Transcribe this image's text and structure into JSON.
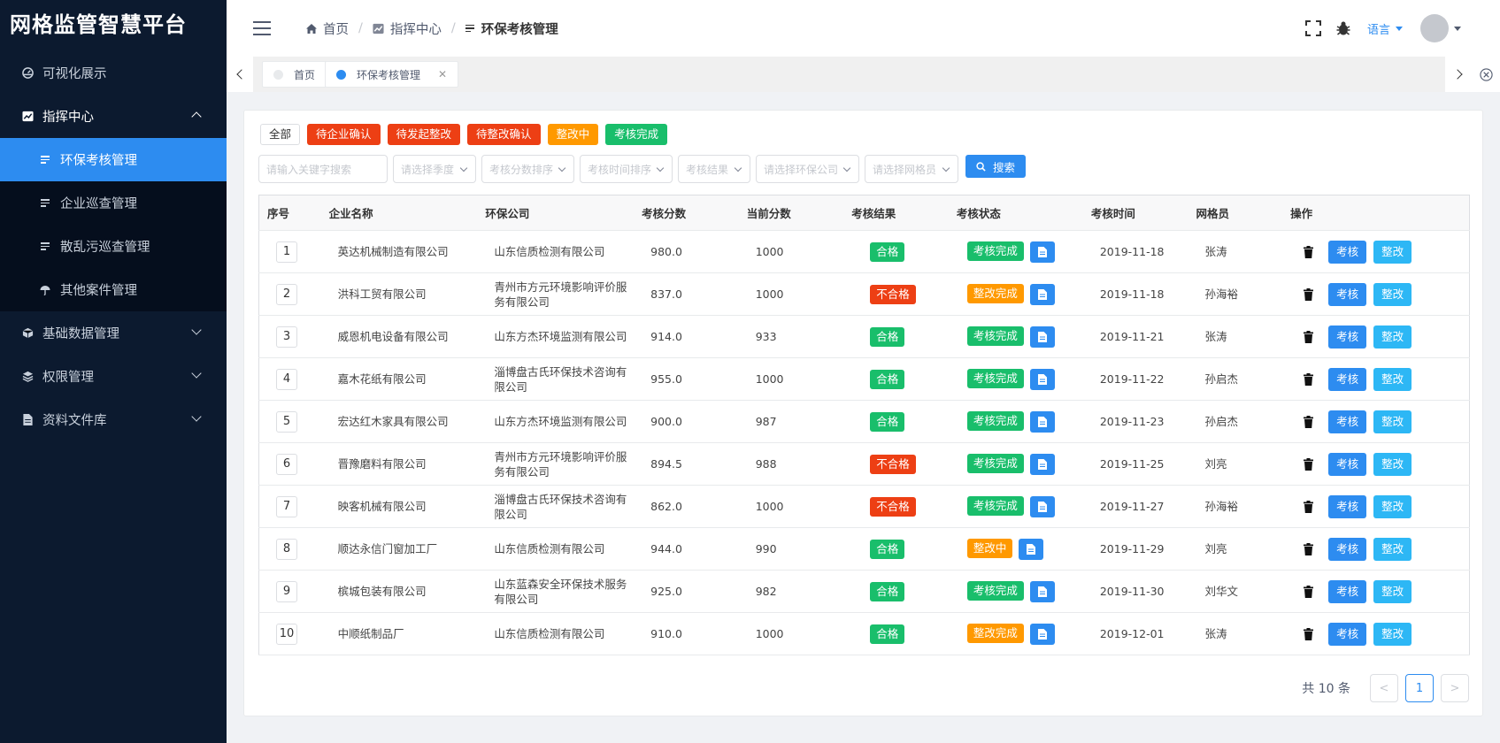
{
  "app": {
    "title": "网格监管智慧平台"
  },
  "sidebar": {
    "items": [
      {
        "label": "可视化展示",
        "icon": "dashboard-icon"
      },
      {
        "label": "指挥中心",
        "icon": "chart-icon",
        "open": true,
        "children": [
          {
            "label": "环保考核管理",
            "active": true
          },
          {
            "label": "企业巡查管理"
          },
          {
            "label": "散乱污巡查管理"
          },
          {
            "label": "其他案件管理"
          }
        ]
      },
      {
        "label": "基础数据管理",
        "icon": "cube-icon"
      },
      {
        "label": "权限管理",
        "icon": "layers-icon"
      },
      {
        "label": "资料文件库",
        "icon": "document-icon"
      }
    ]
  },
  "header": {
    "breadcrumb": [
      "首页",
      "指挥中心",
      "环保考核管理"
    ],
    "language_label": "语言"
  },
  "tabs": [
    {
      "label": "首页"
    },
    {
      "label": "环保考核管理",
      "active": true
    }
  ],
  "filters": {
    "tags": [
      {
        "label": "全部",
        "style": "plain"
      },
      {
        "label": "待企业确认",
        "style": "red"
      },
      {
        "label": "待发起整改",
        "style": "red"
      },
      {
        "label": "待整改确认",
        "style": "red"
      },
      {
        "label": "整改中",
        "style": "orange"
      },
      {
        "label": "考核完成",
        "style": "green"
      }
    ],
    "keyword_placeholder": "请输入关键字搜索",
    "selects": [
      "请选择季度",
      "考核分数排序",
      "考核时间排序",
      "考核结果",
      "请选择环保公司",
      "请选择网格员"
    ],
    "search_label": "搜索"
  },
  "table": {
    "columns": [
      "序号",
      "企业名称",
      "环保公司",
      "考核分数",
      "当前分数",
      "考核结果",
      "考核状态",
      "考核时间",
      "网格员",
      "操作"
    ],
    "op_labels": {
      "review": "考核",
      "rectify": "整改"
    },
    "rows": [
      {
        "idx": "1",
        "company": "英达机械制造有限公司",
        "eco": "山东信质检测有限公司",
        "score": "980.0",
        "current": "1000",
        "result": "合格",
        "result_color": "green",
        "status": "考核完成",
        "status_color": "green",
        "date": "2019-11-18",
        "grid": "张涛"
      },
      {
        "idx": "2",
        "company": "洪科工贸有限公司",
        "eco": "青州市方元环境影响评价服务有限公司",
        "score": "837.0",
        "current": "1000",
        "result": "不合格",
        "result_color": "red",
        "status": "整改完成",
        "status_color": "orange",
        "date": "2019-11-18",
        "grid": "孙海裕"
      },
      {
        "idx": "3",
        "company": "威恩机电设备有限公司",
        "eco": "山东方杰环境监测有限公司",
        "score": "914.0",
        "current": "933",
        "result": "合格",
        "result_color": "green",
        "status": "考核完成",
        "status_color": "green",
        "date": "2019-11-21",
        "grid": "张涛"
      },
      {
        "idx": "4",
        "company": "嘉木花纸有限公司",
        "eco": "淄博盘古氏环保技术咨询有限公司",
        "score": "955.0",
        "current": "1000",
        "result": "合格",
        "result_color": "green",
        "status": "考核完成",
        "status_color": "green",
        "date": "2019-11-22",
        "grid": "孙启杰"
      },
      {
        "idx": "5",
        "company": "宏达红木家具有限公司",
        "eco": "山东方杰环境监测有限公司",
        "score": "900.0",
        "current": "987",
        "result": "合格",
        "result_color": "green",
        "status": "考核完成",
        "status_color": "green",
        "date": "2019-11-23",
        "grid": "孙启杰"
      },
      {
        "idx": "6",
        "company": "晋豫磨料有限公司",
        "eco": "青州市方元环境影响评价服务有限公司",
        "score": "894.5",
        "current": "988",
        "result": "不合格",
        "result_color": "red",
        "status": "考核完成",
        "status_color": "green",
        "date": "2019-11-25",
        "grid": "刘亮"
      },
      {
        "idx": "7",
        "company": "映客机械有限公司",
        "eco": "淄博盘古氏环保技术咨询有限公司",
        "score": "862.0",
        "current": "1000",
        "result": "不合格",
        "result_color": "red",
        "status": "考核完成",
        "status_color": "green",
        "date": "2019-11-27",
        "grid": "孙海裕"
      },
      {
        "idx": "8",
        "company": "顺达永信门窗加工厂",
        "eco": "山东信质检测有限公司",
        "score": "944.0",
        "current": "990",
        "result": "合格",
        "result_color": "green",
        "status": "整改中",
        "status_color": "orange",
        "date": "2019-11-29",
        "grid": "刘亮"
      },
      {
        "idx": "9",
        "company": "槟城包装有限公司",
        "eco": "山东蓝森安全环保技术服务有限公司",
        "score": "925.0",
        "current": "982",
        "result": "合格",
        "result_color": "green",
        "status": "考核完成",
        "status_color": "green",
        "date": "2019-11-30",
        "grid": "刘华文"
      },
      {
        "idx": "10",
        "company": "中顺纸制品厂",
        "eco": "山东信质检测有限公司",
        "score": "910.0",
        "current": "1000",
        "result": "合格",
        "result_color": "green",
        "status": "整改完成",
        "status_color": "orange",
        "date": "2019-12-01",
        "grid": "张涛"
      }
    ]
  },
  "pagination": {
    "total_label": "共 10 条",
    "current_page": "1",
    "prev": "<",
    "next": ">"
  },
  "colors": {
    "primary": "#2d8cf0",
    "danger": "#ed3f14",
    "warning": "#ff9900",
    "success": "#19be6b",
    "info": "#2db7f5",
    "sidebar_bg": "#0c1a2f"
  }
}
